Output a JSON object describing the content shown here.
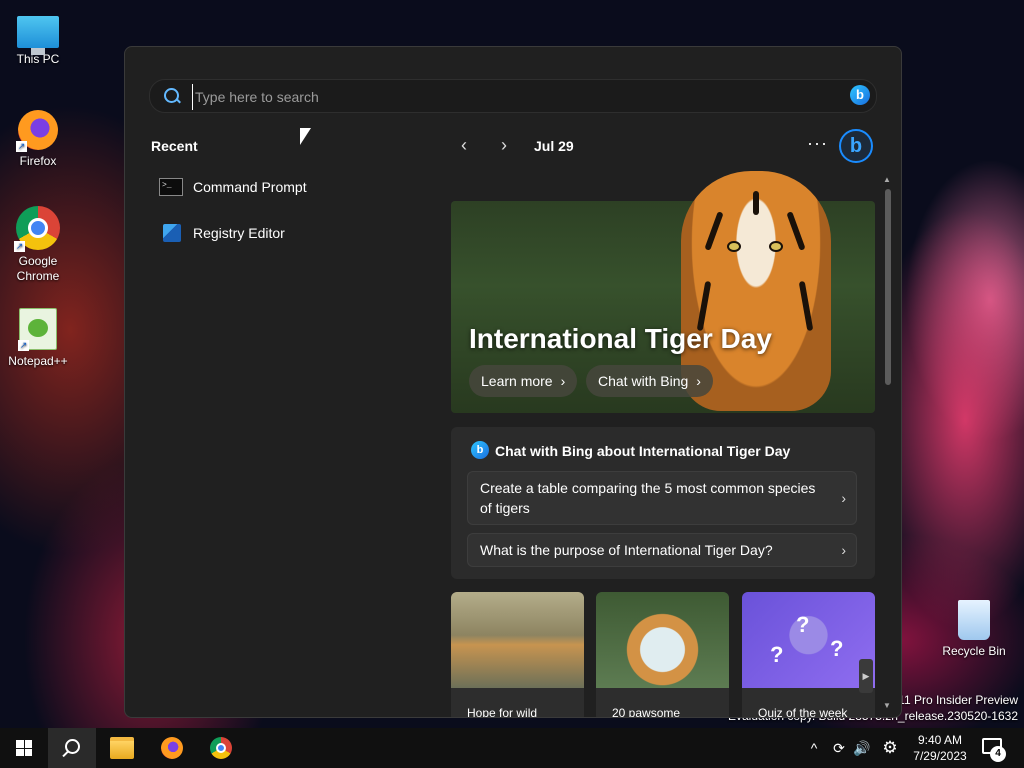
{
  "desktop": {
    "icons": [
      {
        "label": "This PC"
      },
      {
        "label": "Firefox"
      },
      {
        "label": "Google Chrome"
      },
      {
        "label": "Notepad++"
      },
      {
        "label": "Recycle Bin"
      }
    ],
    "watermark": {
      "line1": "s 11 Pro Insider Preview",
      "line2": "Evaluation copy. Build 23575.zn_release.230520-1632"
    }
  },
  "search": {
    "placeholder": "Type here to search",
    "value": "",
    "bing_label": "b"
  },
  "recent": {
    "title": "Recent",
    "items": [
      {
        "label": "Command Prompt",
        "icon": "command-prompt-icon"
      },
      {
        "label": "Registry Editor",
        "icon": "registry-editor-icon"
      }
    ]
  },
  "highlights": {
    "date": "Jul 29",
    "prev_glyph": "‹",
    "next_glyph": "›",
    "more_glyph": "···",
    "bing_glyph": "b",
    "hero": {
      "title": "International Tiger Day",
      "buttons": [
        {
          "label": "Learn more"
        },
        {
          "label": "Chat with Bing"
        }
      ]
    },
    "bing_card": {
      "heading": "Chat with Bing about International Tiger Day",
      "suggestions": [
        {
          "label": "Create a table comparing the 5 most common species of tigers"
        },
        {
          "label": "What is the purpose of International Tiger Day?"
        }
      ]
    },
    "tiles": [
      {
        "caption": "Hope for wild"
      },
      {
        "caption": "20 pawsome"
      },
      {
        "caption": "Quiz of the week"
      }
    ]
  },
  "taskbar": {
    "clock": {
      "time": "9:40 AM",
      "date": "7/29/2023"
    },
    "notification_count": "4",
    "tray_glyphs": {
      "chevron": "^",
      "speaker": "🔊",
      "gear": "⚙"
    }
  },
  "colors": {
    "panel_bg": "#202020",
    "accent": "#1a8cff",
    "taskbar_bg": "#101010"
  }
}
